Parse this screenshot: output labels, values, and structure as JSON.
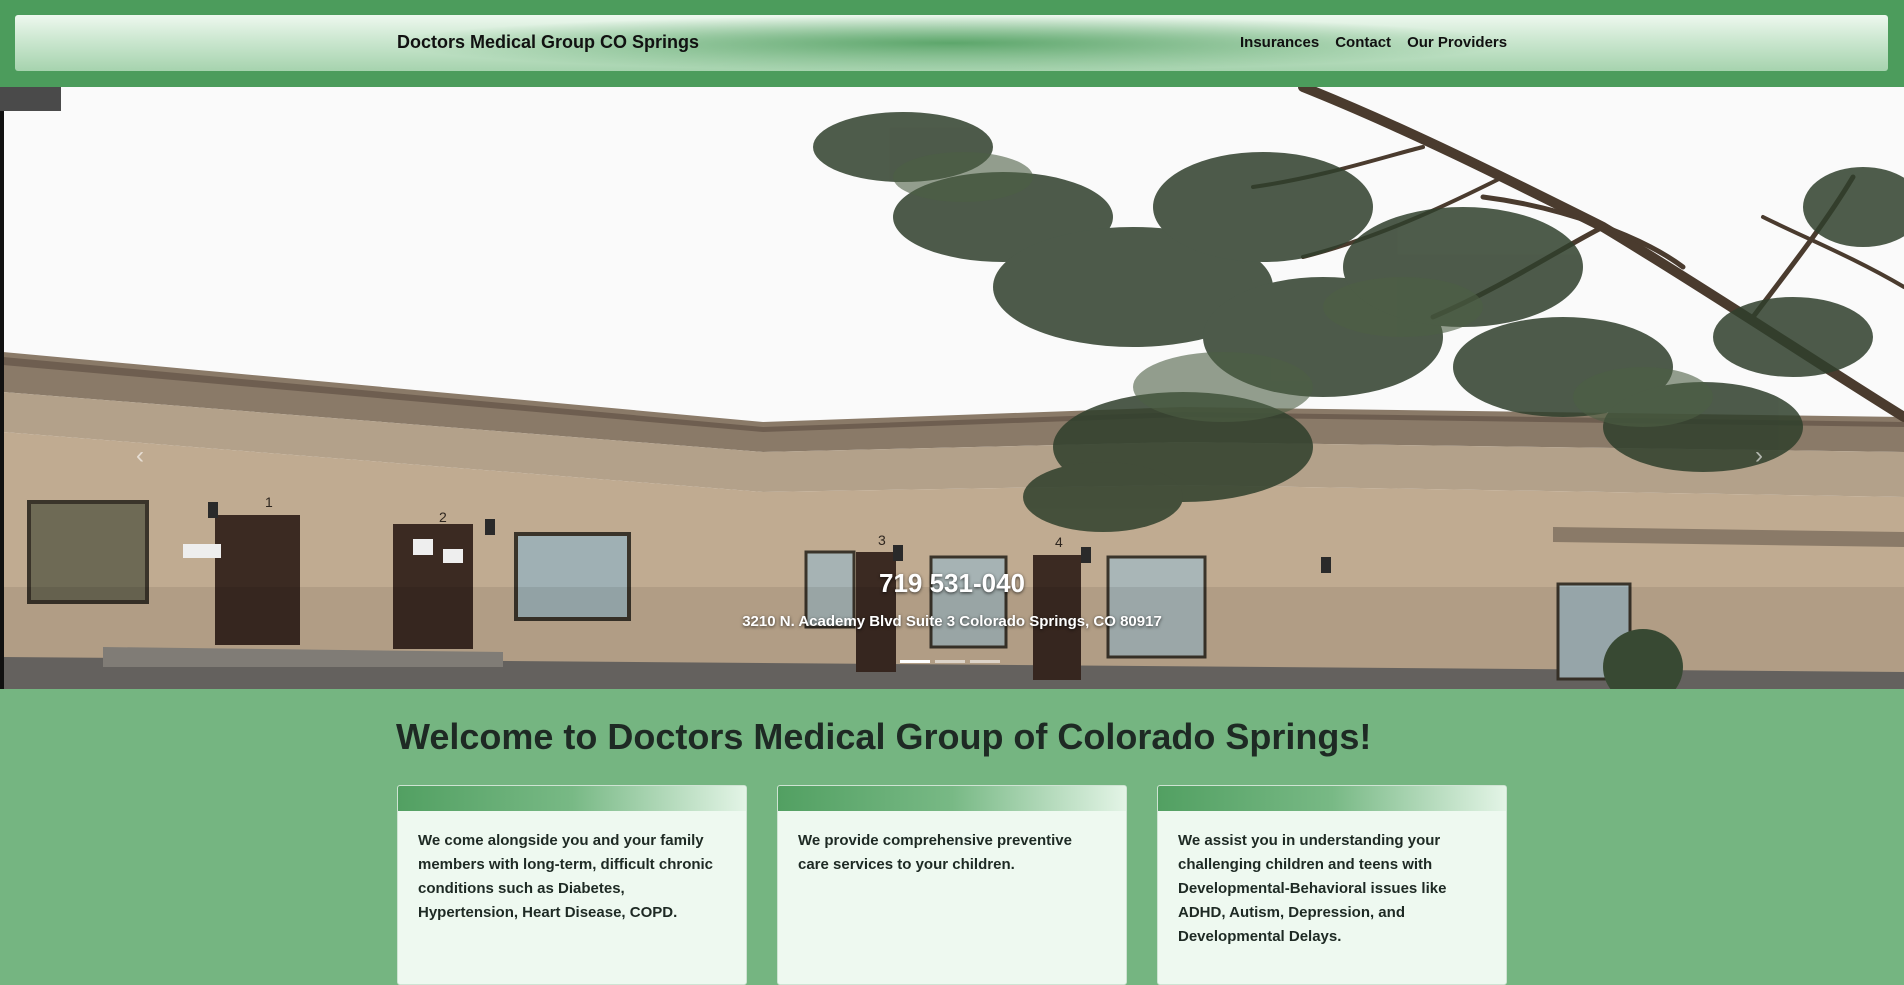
{
  "header": {
    "brand": "Doctors Medical Group CO Springs",
    "nav": [
      "Insurances",
      "Contact",
      "Our Providers"
    ]
  },
  "hero": {
    "phone": "719 531-040",
    "address": "3210 N. Academy Blvd Suite 3 Colorado Springs, CO 80917",
    "prev_label": "‹",
    "next_label": "›",
    "slide_count": 3,
    "active_slide": 1,
    "door_numbers": [
      "1",
      "2",
      "3",
      "4"
    ]
  },
  "main": {
    "welcome_title": "Welcome to Doctors Medical Group of Colorado Springs!",
    "cards": [
      {
        "text": "We come alongside you and your family members with long-term, difficult chronic conditions such as Diabetes, Hypertension, Heart Disease, COPD."
      },
      {
        "text": "We provide comprehensive preventive care services to your children."
      },
      {
        "text": "We assist you in understanding your challenging children and teens with Developmental-Behavioral issues like ADHD, Autism, Depression, and Developmental Delays."
      }
    ]
  },
  "colors": {
    "header_band": "#4c9c5c",
    "page_bg": "#75b581",
    "card_bg": "#eef9f0"
  }
}
